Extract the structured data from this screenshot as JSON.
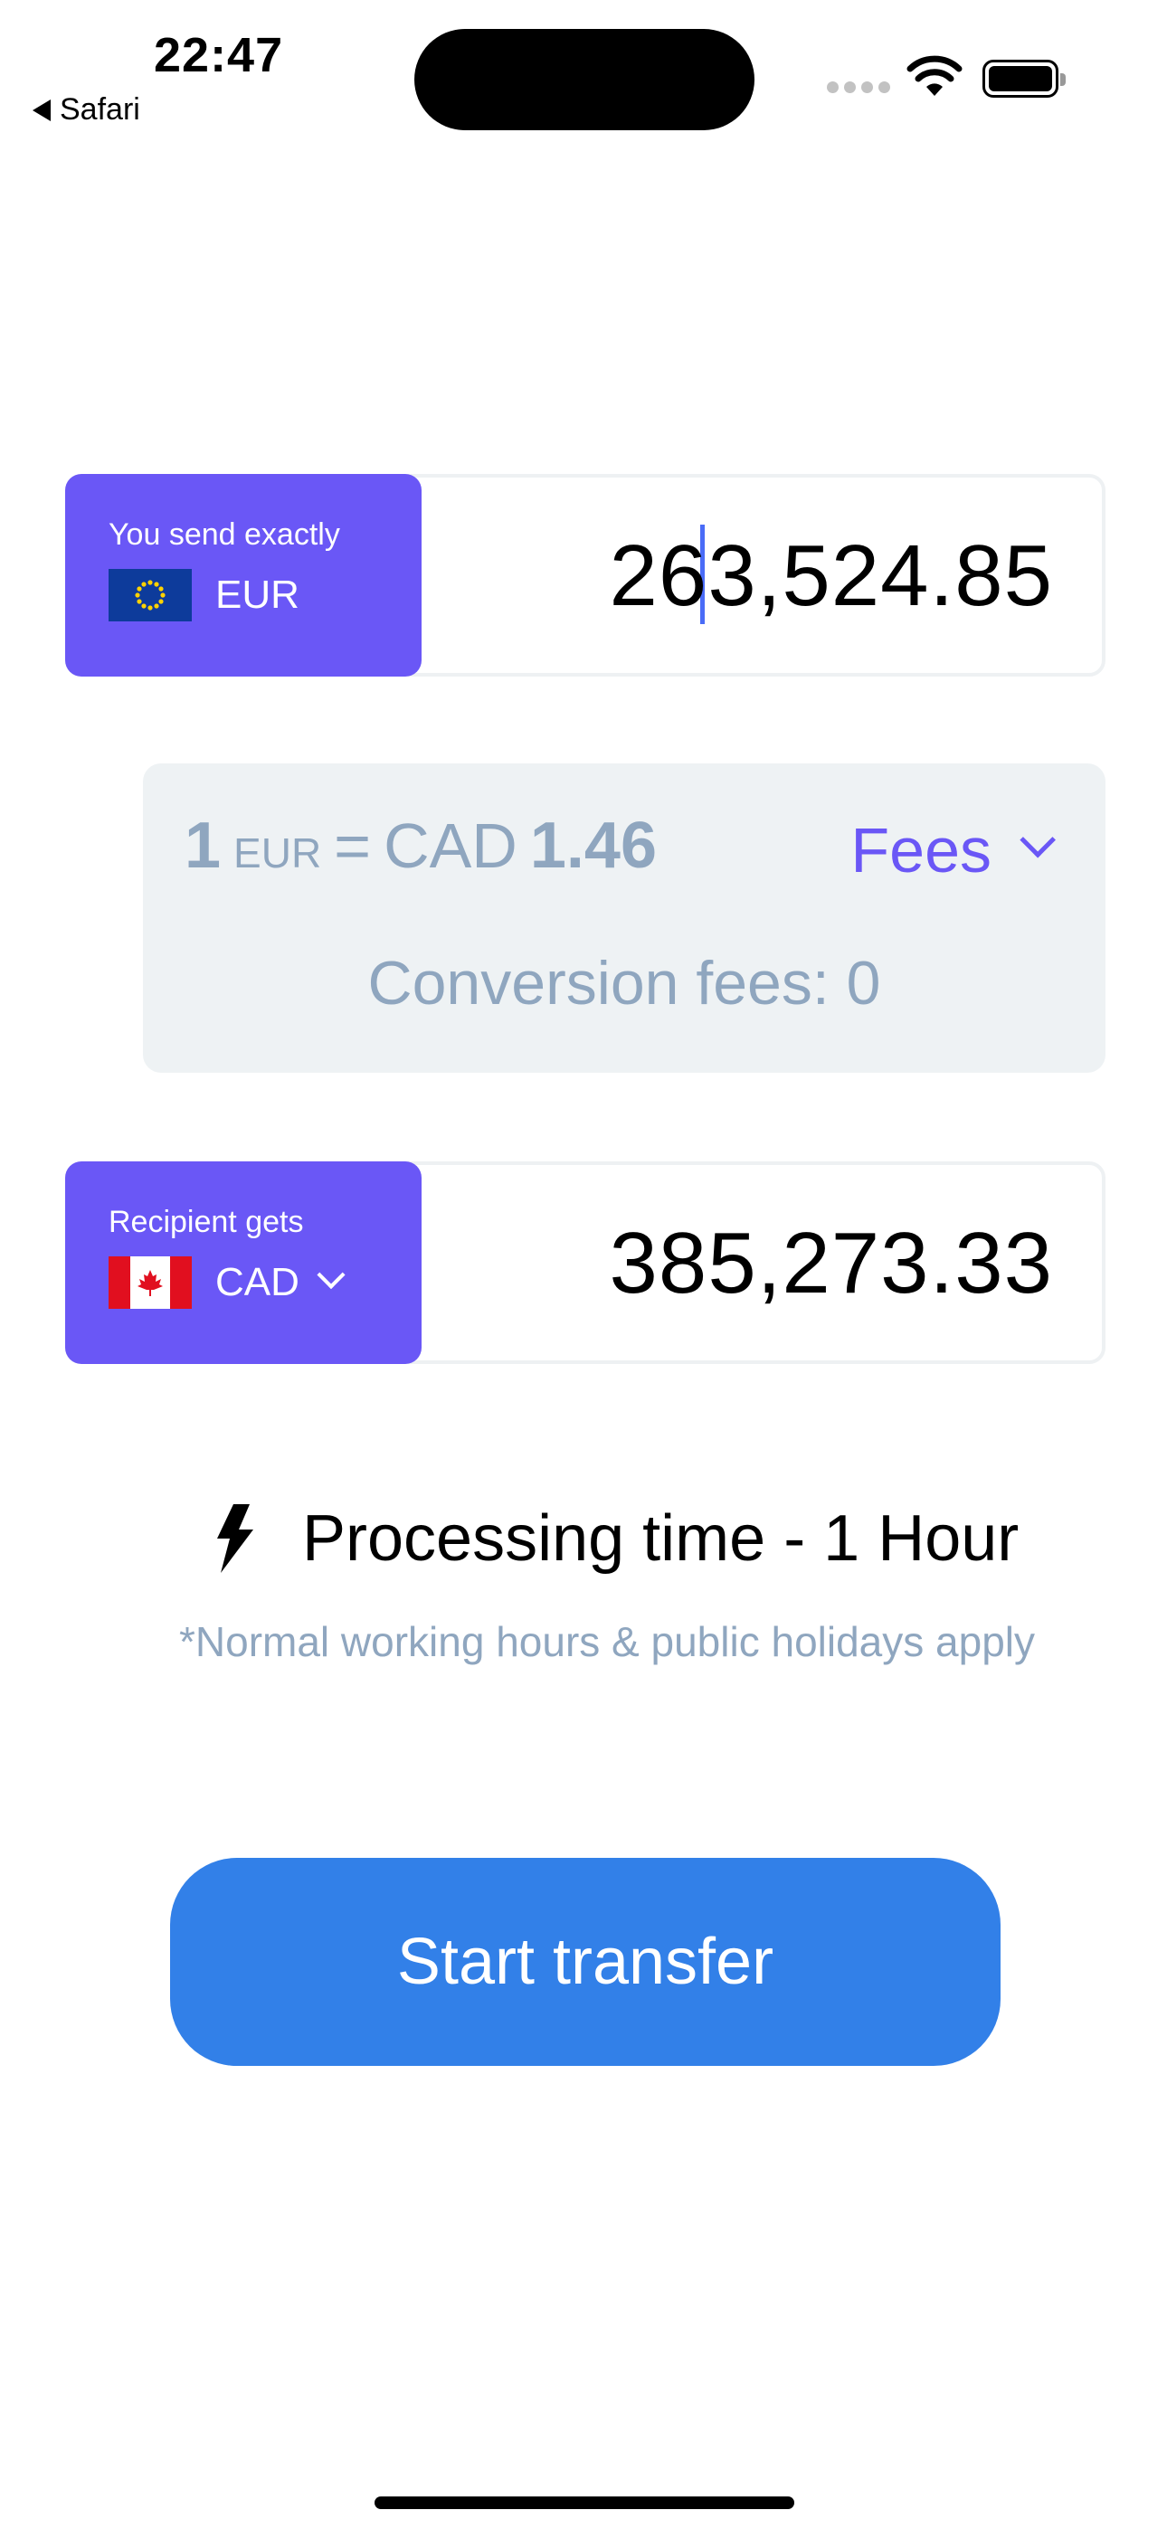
{
  "status_bar": {
    "time": "22:47",
    "back_label": "Safari",
    "icons": [
      "signal-icon",
      "wifi-icon",
      "battery-icon"
    ]
  },
  "send": {
    "label": "You send exactly",
    "currency": "EUR",
    "flag": "eu-flag-icon",
    "amount": "263,524.85"
  },
  "rate": {
    "base_amount": "1",
    "base_currency": "EUR",
    "equals": "=",
    "quote_currency": "CAD",
    "quote_amount": "1.46",
    "fees_label": "Fees",
    "conversion_fees": "Conversion fees: 0"
  },
  "receive": {
    "label": "Recipient gets",
    "currency": "CAD",
    "flag": "canada-flag-icon",
    "amount": "385,273.33"
  },
  "processing": {
    "text": "Processing time - 1 Hour",
    "note": "*Normal working hours & public holidays apply"
  },
  "actions": {
    "start_label": "Start transfer"
  },
  "colors": {
    "accent_purple": "#6a57f6",
    "button_blue": "#3280e8",
    "muted_text": "#8fa6bf",
    "rate_bg": "#eef2f4"
  }
}
